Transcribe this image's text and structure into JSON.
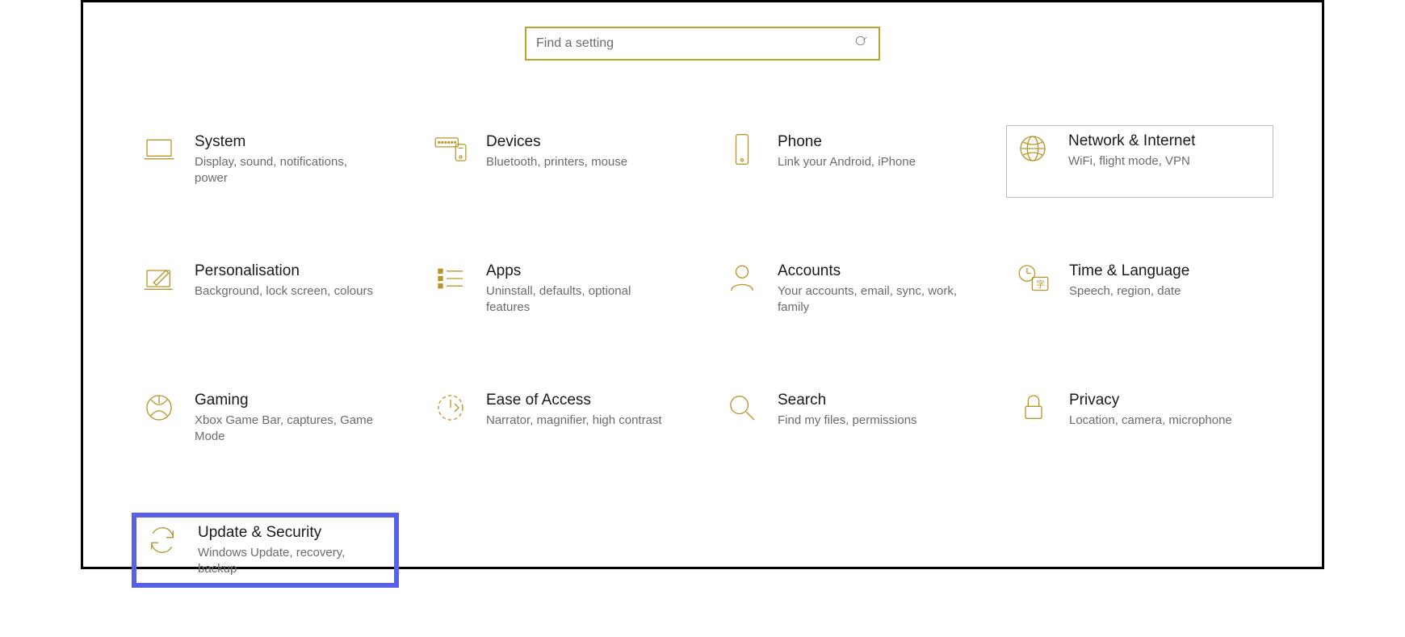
{
  "search": {
    "placeholder": "Find a setting"
  },
  "cards": {
    "system": {
      "title": "System",
      "desc": "Display, sound, notifications, power"
    },
    "devices": {
      "title": "Devices",
      "desc": "Bluetooth, printers, mouse"
    },
    "phone": {
      "title": "Phone",
      "desc": "Link your Android, iPhone"
    },
    "network": {
      "title": "Network & Internet",
      "desc": "WiFi, flight mode, VPN"
    },
    "personalisation": {
      "title": "Personalisation",
      "desc": "Background, lock screen, colours"
    },
    "apps": {
      "title": "Apps",
      "desc": "Uninstall, defaults, optional features"
    },
    "accounts": {
      "title": "Accounts",
      "desc": "Your accounts, email, sync, work, family"
    },
    "time": {
      "title": "Time & Language",
      "desc": "Speech, region, date"
    },
    "gaming": {
      "title": "Gaming",
      "desc": "Xbox Game Bar, captures, Game Mode"
    },
    "ease": {
      "title": "Ease of Access",
      "desc": "Narrator, magnifier, high contrast"
    },
    "searchcat": {
      "title": "Search",
      "desc": "Find my files, permissions"
    },
    "privacy": {
      "title": "Privacy",
      "desc": "Location, camera, microphone"
    },
    "update": {
      "title": "Update & Security",
      "desc": "Windows Update, recovery, backup"
    }
  }
}
